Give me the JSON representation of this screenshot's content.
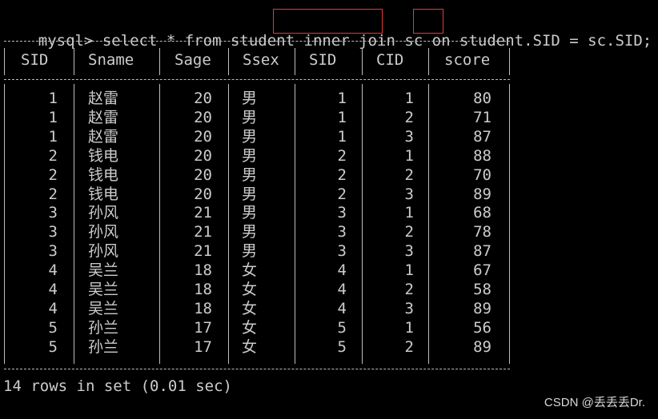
{
  "terminal": {
    "prompt": "mysql>",
    "command_parts": [
      " select * from student ",
      "inner join",
      " sc ",
      "on",
      " student.SID = sc.SID;"
    ],
    "highlight_color": "#e53935",
    "columns": [
      "SID",
      "Sname",
      "Sage",
      "Ssex",
      "SID",
      "CID",
      "score"
    ],
    "rows": [
      [
        "1",
        "赵雷",
        "20",
        "男",
        "1",
        "1",
        "80"
      ],
      [
        "1",
        "赵雷",
        "20",
        "男",
        "1",
        "2",
        "71"
      ],
      [
        "1",
        "赵雷",
        "20",
        "男",
        "1",
        "3",
        "87"
      ],
      [
        "2",
        "钱电",
        "20",
        "男",
        "2",
        "1",
        "88"
      ],
      [
        "2",
        "钱电",
        "20",
        "男",
        "2",
        "2",
        "70"
      ],
      [
        "2",
        "钱电",
        "20",
        "男",
        "2",
        "3",
        "89"
      ],
      [
        "3",
        "孙风",
        "21",
        "男",
        "3",
        "1",
        "68"
      ],
      [
        "3",
        "孙风",
        "21",
        "男",
        "3",
        "2",
        "78"
      ],
      [
        "3",
        "孙风",
        "21",
        "男",
        "3",
        "3",
        "87"
      ],
      [
        "4",
        "吴兰",
        "18",
        "女",
        "4",
        "1",
        "67"
      ],
      [
        "4",
        "吴兰",
        "18",
        "女",
        "4",
        "2",
        "58"
      ],
      [
        "4",
        "吴兰",
        "18",
        "女",
        "4",
        "3",
        "89"
      ],
      [
        "5",
        "孙兰",
        "17",
        "女",
        "5",
        "1",
        "56"
      ],
      [
        "5",
        "孙兰",
        "17",
        "女",
        "5",
        "2",
        "89"
      ]
    ],
    "result_summary": "14 rows in set (0.01 sec)",
    "watermark": "CSDN @丢丢丢Dr."
  }
}
